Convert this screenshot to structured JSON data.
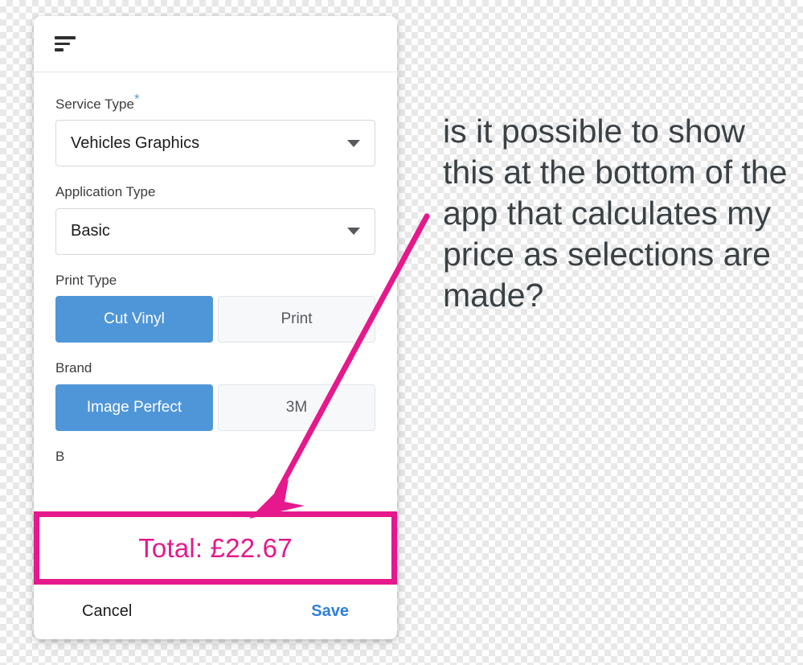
{
  "app": {
    "header": {
      "menu_icon": "sort-icon"
    },
    "fields": [
      {
        "label": "Service Type",
        "required": true,
        "required_marker": "*",
        "type": "select",
        "value": "Vehicles Graphics",
        "caret_icon": "chevron-down-icon"
      },
      {
        "label": "Application Type",
        "required": false,
        "required_marker": "",
        "type": "select",
        "value": "Basic",
        "caret_icon": "chevron-down-icon"
      },
      {
        "label": "Print Type",
        "required": false,
        "required_marker": "",
        "type": "toggle",
        "options": [
          {
            "label": "Cut Vinyl",
            "selected": true
          },
          {
            "label": "Print",
            "selected": false
          }
        ]
      },
      {
        "label": "Brand",
        "required": false,
        "required_marker": "",
        "type": "toggle",
        "options": [
          {
            "label": "Image Perfect",
            "selected": true
          },
          {
            "label": "3M",
            "selected": false
          }
        ]
      }
    ],
    "clipped_field_label": "B",
    "footer": {
      "cancel_label": "Cancel",
      "save_label": "Save"
    }
  },
  "annotation": {
    "total_label": "Total: £22.67",
    "question": "is it possible to show this at the bottom of the app that calculates my price as selections are made?",
    "arrow": {
      "name": "pointer-arrow"
    }
  },
  "colors": {
    "accent_blue": "#4f96d8",
    "link_blue": "#2f80d8",
    "annotation_pink": "#e5188c",
    "required_star_blue": "#5b9bd5",
    "text_dark": "#3a4145"
  }
}
